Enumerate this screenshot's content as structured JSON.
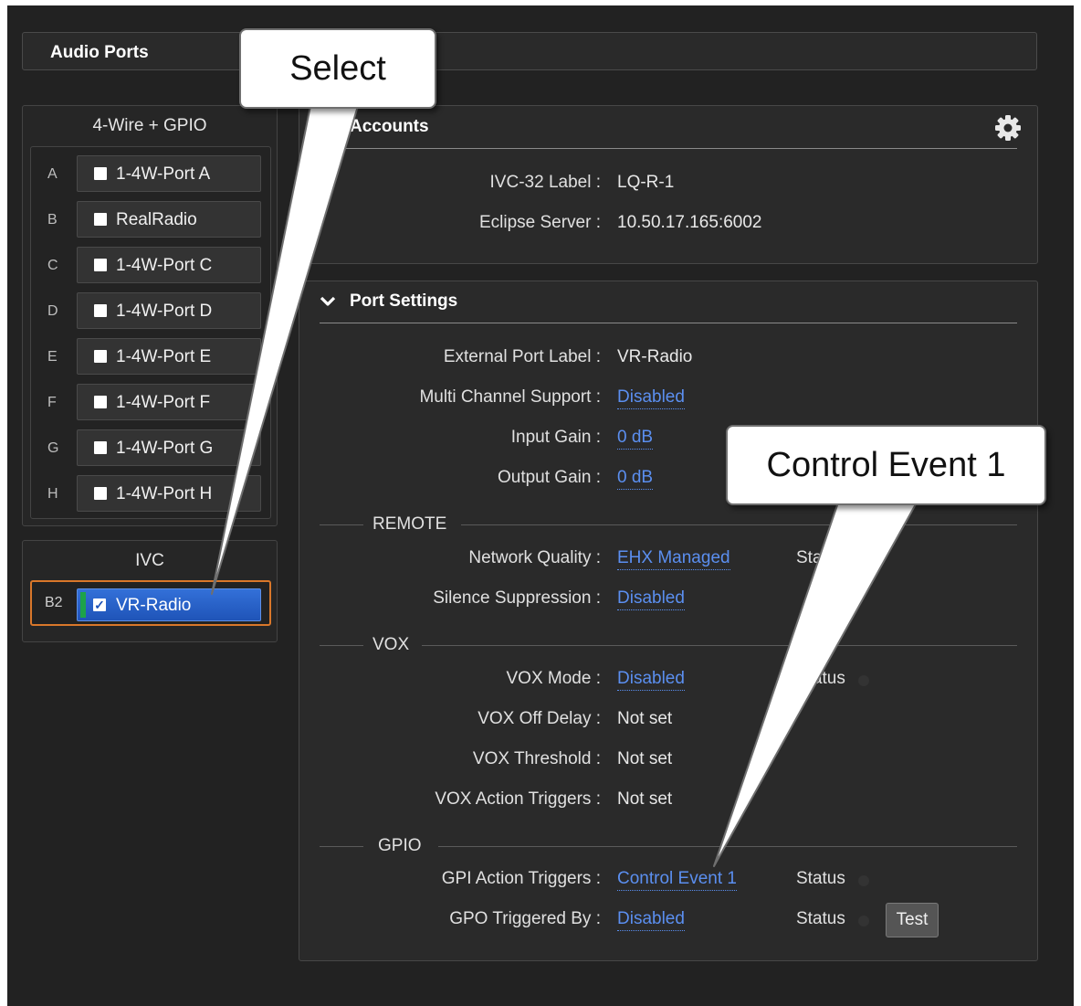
{
  "header": {
    "title": "Audio Ports"
  },
  "four_wire_group": {
    "title": "4-Wire + GPIO",
    "ports": [
      {
        "letter": "A",
        "label": "1-4W-Port A"
      },
      {
        "letter": "B",
        "label": "RealRadio"
      },
      {
        "letter": "C",
        "label": "1-4W-Port C"
      },
      {
        "letter": "D",
        "label": "1-4W-Port D"
      },
      {
        "letter": "E",
        "label": "1-4W-Port E"
      },
      {
        "letter": "F",
        "label": "1-4W-Port F"
      },
      {
        "letter": "G",
        "label": "1-4W-Port G"
      },
      {
        "letter": "H",
        "label": "1-4W-Port H"
      }
    ]
  },
  "ivc_group": {
    "title": "IVC",
    "port": {
      "letter": "B2",
      "label": "VR-Radio",
      "checkmark": "✓"
    }
  },
  "accounts": {
    "title": "Accounts",
    "gear_icon": "gear-icon",
    "rows": [
      {
        "label": "IVC-32 Label :",
        "value": "LQ-R-1"
      },
      {
        "label": "Eclipse Server :",
        "value": "10.50.17.165:6002"
      }
    ]
  },
  "port_settings": {
    "title": "Port Settings",
    "chevron": "chevron-down-icon",
    "rows": [
      {
        "label": "External Port Label :",
        "value": "VR-Radio"
      },
      {
        "label": "Multi Channel Support :",
        "value": "Disabled"
      },
      {
        "label": "Input Gain :",
        "value": "0 dB"
      },
      {
        "label": "Output Gain :",
        "value": "0 dB"
      }
    ],
    "remote": {
      "title": "REMOTE",
      "rows": [
        {
          "label": "Network Quality :",
          "value": "EHX Managed",
          "status": "Status"
        },
        {
          "label": "Silence Suppression :",
          "value": "Disabled"
        }
      ]
    },
    "vox": {
      "title": "VOX",
      "rows": [
        {
          "label": "VOX Mode :",
          "value": "Disabled",
          "status": "Status"
        },
        {
          "label": "VOX Off Delay :",
          "value": "Not set"
        },
        {
          "label": "VOX Threshold :",
          "value": "Not set"
        },
        {
          "label": "VOX Action Triggers :",
          "value": "Not set"
        }
      ]
    },
    "gpio": {
      "title": "GPIO",
      "rows": [
        {
          "label": "GPI Action Triggers :",
          "value": "Control Event 1",
          "status": "Status"
        },
        {
          "label": "GPO Triggered By :",
          "value": "Disabled",
          "status": "Status",
          "button": "Test"
        }
      ]
    }
  },
  "callouts": {
    "select": "Select",
    "control_event": "Control Event 1"
  },
  "colors": {
    "accent_link": "#5b8ff0",
    "selected_border": "#d9772a",
    "selected_button": "#2a64cc",
    "active_bar": "#1da34a"
  }
}
